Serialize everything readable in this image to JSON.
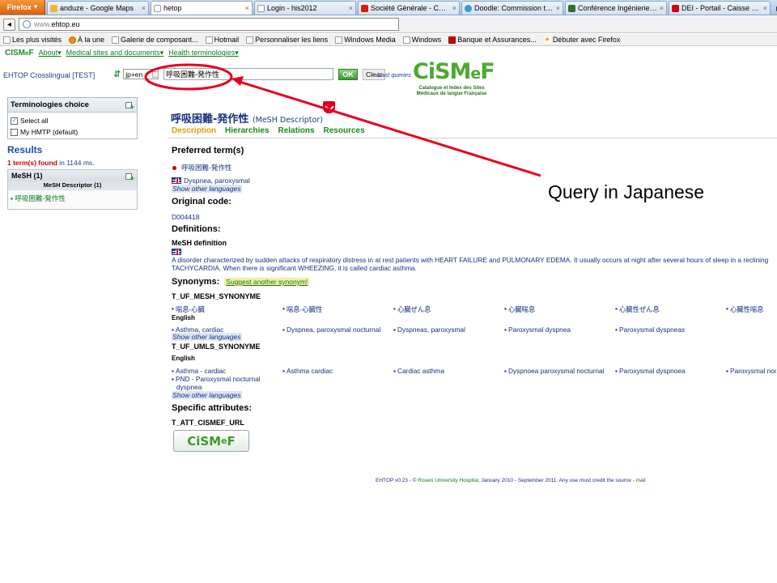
{
  "browser": {
    "app_button": "Firefox",
    "tabs": [
      {
        "label": "anduze - Google Maps",
        "color": "#e9b93a"
      },
      {
        "label": "hetop",
        "color": "#ffffff",
        "active": true
      },
      {
        "label": "Login - his2012",
        "color": "#ffffff"
      },
      {
        "label": "Société Générale - Comptes ...",
        "color": "#d81e05"
      },
      {
        "label": "Doodle: Commission techno",
        "color": "#2c9fd9"
      },
      {
        "label": "Conférence Ingénierie des C...",
        "color": "#2f6e2f"
      },
      {
        "label": "DEI - Portail - Caisse d'Eparg...",
        "color": "#d0021b"
      }
    ],
    "url_scheme": "www.",
    "url_host": "ehtop.eu",
    "bookmarks": [
      {
        "label": "Les plus visités",
        "icon": "folder-icon"
      },
      {
        "label": "À la une",
        "icon": "rss-icon"
      },
      {
        "label": "Galerie de composant...",
        "icon": "page-icon"
      },
      {
        "label": "Hotmail",
        "icon": "page-icon"
      },
      {
        "label": "Personnaliser les liens",
        "icon": "page-icon"
      },
      {
        "label": "Windows Media",
        "icon": "page-icon"
      },
      {
        "label": "Windows",
        "icon": "page-icon"
      },
      {
        "label": "Banque et Assurances...",
        "icon": "bank-icon"
      },
      {
        "label": "Débuter avec Firefox",
        "icon": "firefox-icon"
      }
    ]
  },
  "site": {
    "brand_pre": "CISM",
    "brand_e": "e",
    "brand_post": "F",
    "menu": [
      "About▾",
      "Medical sites and documents▾",
      "Health terminologies▾"
    ],
    "crosslingual_label": "EHTOP Crosslingual [TEST]",
    "language": "jp+en",
    "search_value": "呼吸困難-発作性",
    "ok_label": "OK",
    "clear_label": "Clear",
    "last_queries": "Last queries",
    "logo_main": "CiSM",
    "logo_e": "e",
    "logo_f": "F",
    "logo_sub_1": "Catalogue et Index des Sites",
    "logo_sub_2": "Médicaux de langue Française"
  },
  "left": {
    "term_title": "Terminologies choice",
    "select_all": "Select all",
    "my_hmtp": "My HMTP (default)",
    "results_title": "Results",
    "found_bold": "1 term(s) found",
    "found_rest": " in 1144 ms.",
    "mesh_header": "MeSH (1)",
    "mesh_descriptor": "MeSH Descriptor (1)",
    "mesh_hit": "呼吸困難-発作性"
  },
  "main": {
    "title": "呼吸困難-発作性",
    "title_sub": "(MeSH Descriptor)",
    "tabs": [
      "Description",
      "Hierarchies",
      "Relations",
      "Resources"
    ],
    "preferred_h": "Preferred term(s)",
    "preferred_jp": "呼吸困難-発作性",
    "preferred_en": "Dyspnea, paroxysmal",
    "show_other": "Show other languages",
    "original_h": "Original code:",
    "original_code": "D004418",
    "definitions_h": "Definitions:",
    "mesh_def_h": "MeSH definition",
    "def_line1": "A disorder characterized by sudden attacks of respiratory distress in at rest patients with HEART FAILURE and PULMONARY EDEMA. It usually occurs at night after several hours of sleep in a reclining",
    "def_line2": "TACHYCARDIA. When there is significant WHEEZING, it is called cardiac asthma.",
    "synonyms_h": "Synonyms:",
    "suggest": "Suggest another synonym!",
    "uf_mesh_h": "T_UF_MESH_SYNONYME",
    "uf_mesh_jp": [
      "喘息-心臓",
      "喘息-心臓性",
      "心臓ぜん息",
      "心臓喘息",
      "心臓性ぜん息",
      "心臓性喘息"
    ],
    "english_h": "English",
    "uf_mesh_en": [
      "Asthma, cardiac",
      "Dyspnea, paroxysmal nocturnal",
      "Dyspneas, paroxysmal",
      "Paroxysmal dyspnea",
      "Paroxysmal dyspneas"
    ],
    "uf_umls_h": "T_UF_UMLS_SYNONYME",
    "english_h2": "English",
    "uf_umls_en": [
      "Asthma - cardiac",
      "Asthma cardiac",
      "Cardiac asthma",
      "Dyspnoea paroxysmal nocturnal",
      "Paroxysmal dyspnoea",
      "Paroxysmal noc"
    ],
    "pnd_1": "PND - Paroxysmal nocturnal",
    "pnd_2": "dyspnea",
    "specific_h": "Specific attributes:",
    "att_h": "T_ATT_CISMEF_URL",
    "badge_main": "CiSM",
    "badge_e": "e",
    "badge_f": "F",
    "footer_pre": "EHTOP v0.23 - © ",
    "footer_hosp": "Rouen University Hospital",
    "footer_mid": ", January 2010 - September 2011. Any use must credit the source - ",
    "footer_mail": "mail"
  },
  "annotation": {
    "text": "Query in Japanese",
    "color": "#e8001c"
  }
}
